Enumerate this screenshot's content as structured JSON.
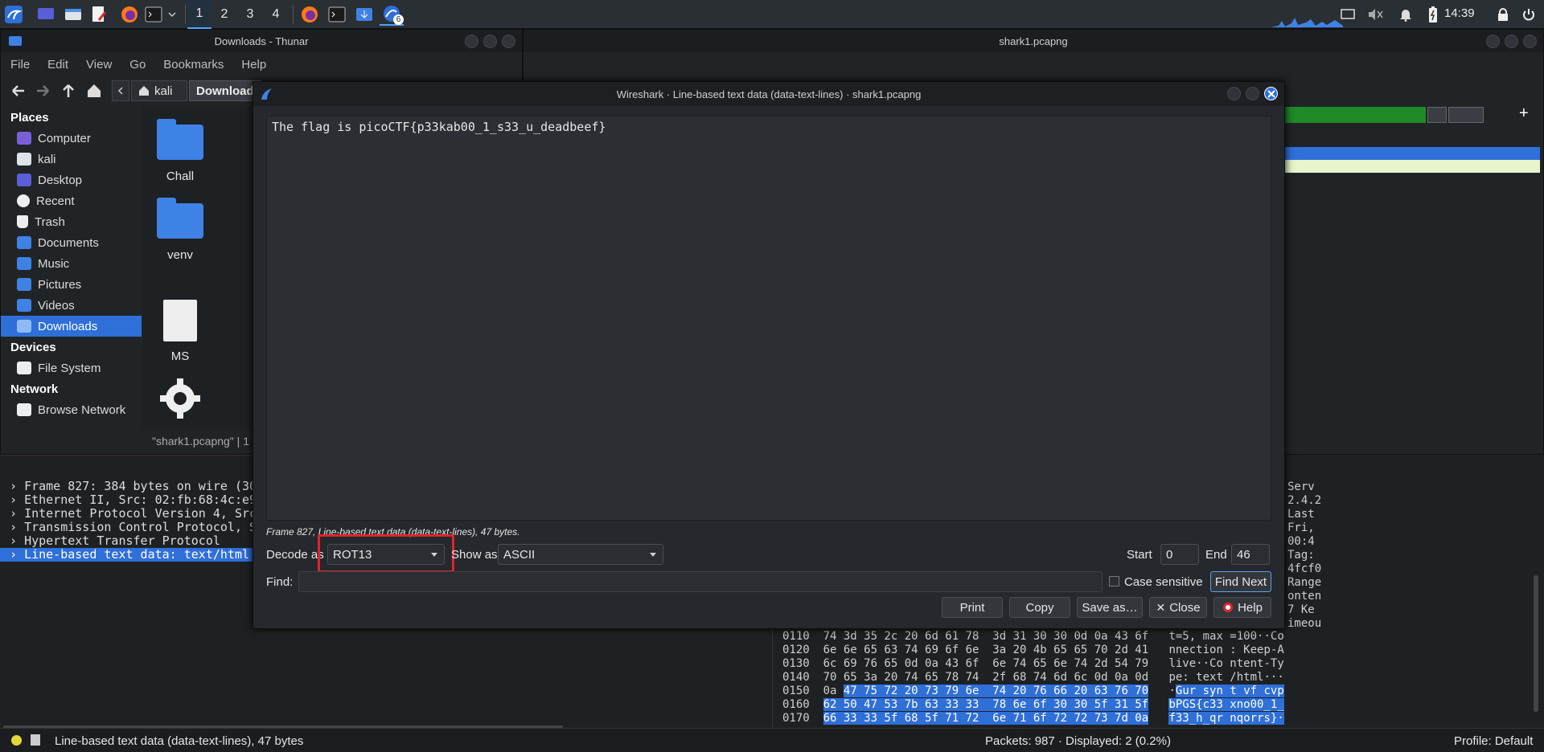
{
  "taskbar": {
    "workspaces": [
      "1",
      "2",
      "3",
      "4"
    ],
    "active_workspace": "1",
    "badge": "6",
    "clock": "14:39"
  },
  "thunar": {
    "title": "Downloads - Thunar",
    "menu": [
      "File",
      "Edit",
      "View",
      "Go",
      "Bookmarks",
      "Help"
    ],
    "path": [
      "kali",
      "Download"
    ],
    "places_header": "Places",
    "places": [
      "Computer",
      "kali",
      "Desktop",
      "Recent",
      "Trash",
      "Documents",
      "Music",
      "Pictures",
      "Videos",
      "Downloads"
    ],
    "devices_header": "Devices",
    "devices": [
      "File System"
    ],
    "network_header": "Network",
    "network": [
      "Browse Network"
    ],
    "files": [
      "Chall",
      "venv",
      "MS",
      ""
    ],
    "status": "\"shark1.pcapng\" | 1"
  },
  "wireshark": {
    "title": "shark1.pcapng",
    "tree": [
      "Frame 827: 384 bytes on wire (30",
      "Ethernet II, Src: 02:fb:68:4c:e9",
      "Internet Protocol Version 4, Src",
      "Transmission Control Protocol, S",
      "Hypertext Transfer Protocol",
      "Line-based text data: text/html"
    ],
    "right_text": [
      "Serv",
      "2.4.2",
      "Last",
      "Fri,",
      "00:4",
      "Tag:",
      "4fcf0",
      "Range",
      "onten",
      "7 Ke",
      "imeou"
    ],
    "hex": [
      {
        "off": "0110",
        "bytes": "74 3d 35 2c 20 6d 61 78  3d 31 30 30 0d 0a 43 6f",
        "ascii": "t=5, max =100··Co"
      },
      {
        "off": "0120",
        "bytes": "6e 6e 65 63 74 69 6f 6e  3a 20 4b 65 65 70 2d 41",
        "ascii": "nnection : Keep-A"
      },
      {
        "off": "0130",
        "bytes": "6c 69 76 65 0d 0a 43 6f  6e 74 65 6e 74 2d 54 79",
        "ascii": "live··Co ntent-Ty"
      },
      {
        "off": "0140",
        "bytes": "70 65 3a 20 74 65 78 74  2f 68 74 6d 6c 0d 0a 0d",
        "ascii": "pe: text /html···"
      },
      {
        "off": "0150",
        "bytes_pre": "0a ",
        "bytes": "47 75 72 20 73 79 6e  74 20 76 66 20 63 76 70",
        "ascii_pre": "·",
        "ascii": "Gur syn t vf cvp"
      },
      {
        "off": "0160",
        "bytes": "62 50 47 53 7b 63 33 33  78 6e 6f 30 30 5f 31 5f",
        "ascii": "bPGS{c33 xno00_1_"
      },
      {
        "off": "0170",
        "bytes": "66 33 33 5f 68 5f 71 72  6e 71 6f 72 72 73 7d 0a",
        "ascii": "f33_h_qr nqorrs}·"
      }
    ],
    "statusbar": {
      "field": "Line-based text data (data-text-lines), 47 bytes",
      "packets": "Packets: 987 · Displayed: 2 (0.2%)",
      "profile": "Profile: Default"
    }
  },
  "dialog": {
    "title": "Wireshark · Line-based text data (data-text-lines) · shark1.pcapng",
    "content": "The flag is picoCTF{p33kab00_1_s33_u_deadbeef}",
    "info": "Frame 827, Line-based text data (data-text-lines), 47 bytes.",
    "decode_label": "Decode as",
    "decode_value": "ROT13",
    "show_label": "Show as",
    "show_value": "ASCII",
    "start_label": "Start",
    "start_value": "0",
    "end_label": "End",
    "end_value": "46",
    "find_label": "Find:",
    "find_value": "",
    "case_label": "Case sensitive",
    "find_next": "Find Next",
    "print": "Print",
    "copy": "Copy",
    "save_as": "Save as…",
    "close": "Close",
    "help": "Help",
    "highlight_color": "#e0242c"
  }
}
